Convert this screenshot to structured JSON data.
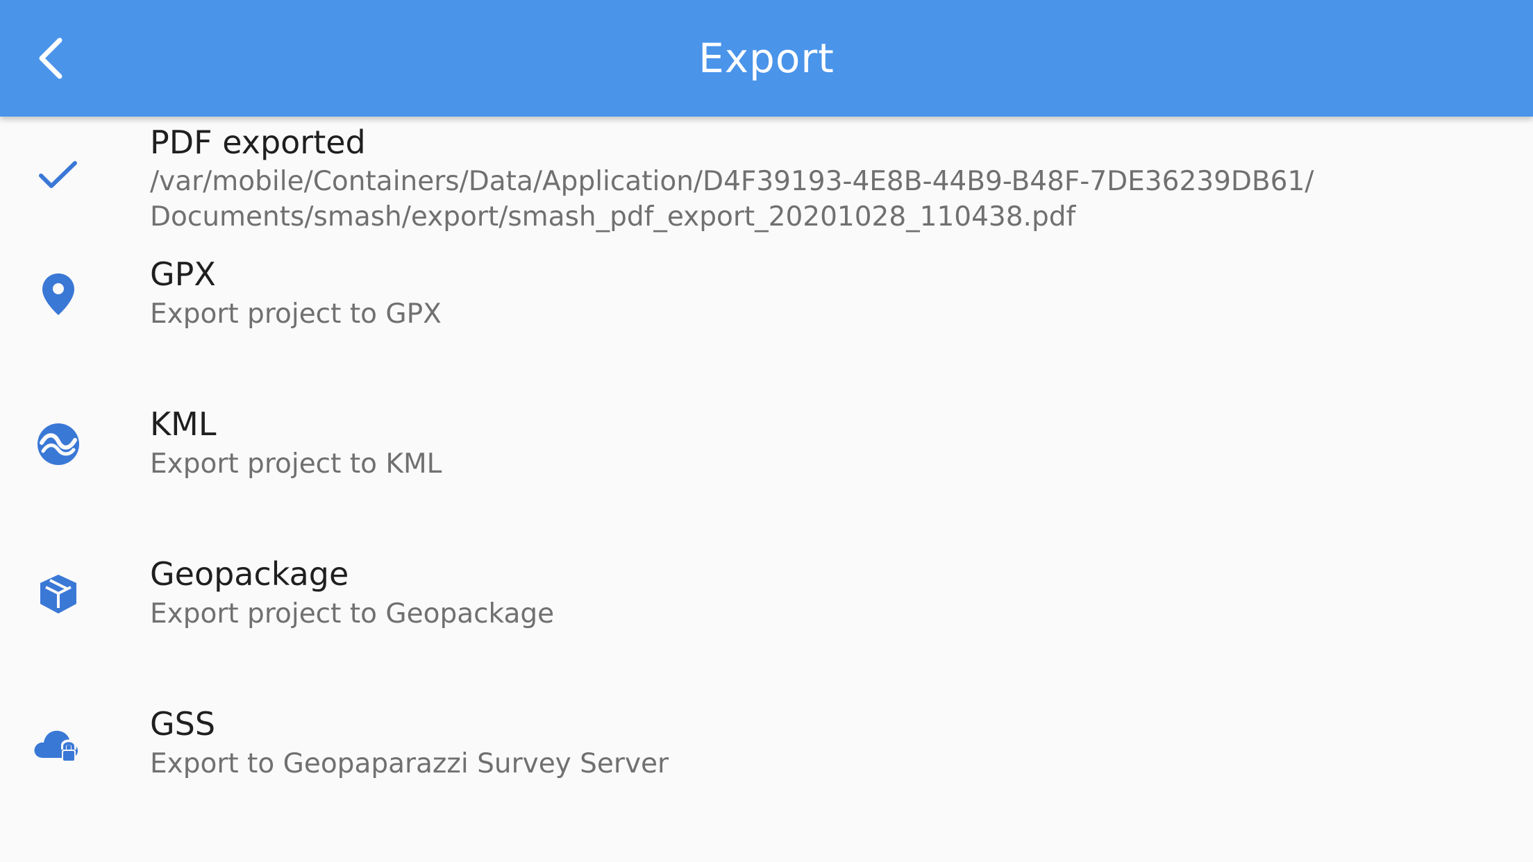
{
  "app_bar": {
    "title": "Export",
    "back_icon": "chevron-left-icon",
    "background_color": "#4a94ea"
  },
  "accent_color": "#3a78d6",
  "items": [
    {
      "icon": "check-icon",
      "title": "PDF exported",
      "path_line_1": "/var/mobile/Containers/Data/Application/D4F39193-4E8B-44B9-B48F-7DE36239DB61/",
      "path_line_2": "Documents/smash/export/smash_pdf_export_20201028_110438.pdf"
    },
    {
      "icon": "location-pin-icon",
      "title": "GPX",
      "subtitle": "Export project to GPX"
    },
    {
      "icon": "earth-icon",
      "title": "KML",
      "subtitle": "Export project to KML"
    },
    {
      "icon": "package-icon",
      "title": "Geopackage",
      "subtitle": "Export project to Geopackage"
    },
    {
      "icon": "cloud-lock-icon",
      "title": "GSS",
      "subtitle": "Export to Geopaparazzi Survey Server"
    }
  ]
}
